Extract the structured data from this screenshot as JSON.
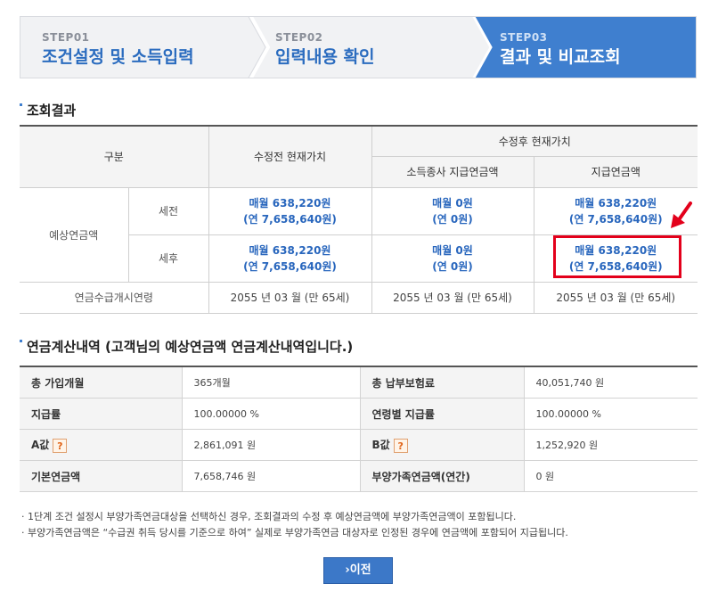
{
  "steps": [
    {
      "num": "STEP01",
      "title": "조건설정 및 소득입력"
    },
    {
      "num": "STEP02",
      "title": "입력내용 확인"
    },
    {
      "num": "STEP03",
      "title": "결과 및 비교조회"
    }
  ],
  "result_section": {
    "title": "조회결과",
    "headers": {
      "category": "구분",
      "before": "수정전 현재가치",
      "after_group": "수정후 현재가치",
      "after_income": "소득종사 지급연금액",
      "after_payment": "지급연금액"
    },
    "row_group_label": "예상연금액",
    "rows": [
      {
        "label": "세전",
        "before": [
          "매월 638,220원",
          "(연 7,658,640원)"
        ],
        "after_income": [
          "매월 0원",
          "(연 0원)"
        ],
        "after_payment": [
          "매월 638,220원",
          "(연 7,658,640원)"
        ]
      },
      {
        "label": "세후",
        "before": [
          "매월 638,220원",
          "(연 7,658,640원)"
        ],
        "after_income": [
          "매월 0원",
          "(연 0원)"
        ],
        "after_payment": [
          "매월 638,220원",
          "(연 7,658,640원)"
        ]
      }
    ],
    "start_age": {
      "label": "연금수급개시연령",
      "before": "2055 년 03 월 (만 65세)",
      "after_income": "2055 년 03 월 (만 65세)",
      "after_payment": "2055 년 03 월 (만 65세)"
    }
  },
  "calc_section": {
    "title": "연금계산내역 (고객님의 예상연금액 연금계산내역입니다.)",
    "rows": [
      [
        {
          "label": "총 가입개월",
          "value": "365개월"
        },
        {
          "label": "총 납부보험료",
          "value": "40,051,740 원"
        }
      ],
      [
        {
          "label": "지급률",
          "value": "100.00000 %"
        },
        {
          "label": "연령별 지급률",
          "value": "100.00000 %"
        }
      ],
      [
        {
          "label": "A값",
          "value": "2,861,091 원",
          "help": "?"
        },
        {
          "label": "B값",
          "value": "1,252,920 원",
          "help": "?"
        }
      ],
      [
        {
          "label": "기본연금액",
          "value": "7,658,746 원"
        },
        {
          "label": "부양가족연금액(연간)",
          "value": "0 원"
        }
      ]
    ]
  },
  "notes": [
    "· 1단계 조건 설정시 부양가족연금대상을 선택하신 경우, 조회결과의 수정 후 예상연금액에 부양가족연금액이 포함됩니다.",
    "· 부양가족연금액은 “수급권 취득 당시를 기준으로 하여” 실제로 부양가족연금 대상자로 인정된 경우에 연금액에 포함되어 지급됩니다."
  ],
  "prev_button": "이전",
  "colors": {
    "accent": "#3f7fcf",
    "value_blue": "#2866bd",
    "highlight": "#e3001b"
  }
}
